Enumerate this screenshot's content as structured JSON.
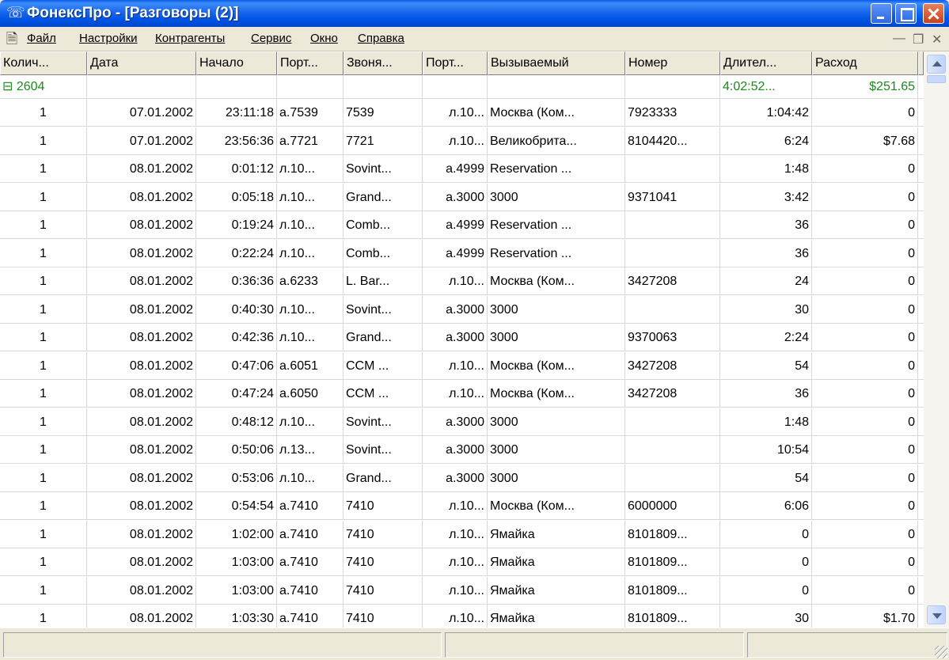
{
  "window": {
    "title": "ФонексПро - [Разговоры (2)]",
    "icon": "phone-icon"
  },
  "menu": {
    "items": [
      "Файл",
      "Настройки",
      "Контрагенты",
      "Сервис",
      "Окно",
      "Справка"
    ]
  },
  "columns": [
    "Колич...",
    "Дата",
    "Начало",
    "Порт...",
    "Звоня...",
    "Порт...",
    "Вызываемый",
    "Номер",
    "Длител...",
    "Расход"
  ],
  "group": {
    "count": "2604",
    "duration": "4:02:52...",
    "cost": "$251.65"
  },
  "rows": [
    [
      "1",
      "07.01.2002",
      "23:11:18",
      "а.7539",
      "7539",
      "л.10...",
      "Москва (Ком...",
      "7923333",
      "1:04:42",
      "0"
    ],
    [
      "1",
      "07.01.2002",
      "23:56:36",
      "а.7721",
      "7721",
      "л.10...",
      "Великобрита...",
      "8104420...",
      "6:24",
      "$7.68"
    ],
    [
      "1",
      "08.01.2002",
      "0:01:12",
      "л.10...",
      "Sovint...",
      "а.4999",
      "Reservation ...",
      "",
      "1:48",
      "0"
    ],
    [
      "1",
      "08.01.2002",
      "0:05:18",
      "л.10...",
      "Grand...",
      "а.3000",
      "3000",
      "9371041",
      "3:42",
      "0"
    ],
    [
      "1",
      "08.01.2002",
      "0:19:24",
      "л.10...",
      "Comb...",
      "а.4999",
      "Reservation ...",
      "",
      "36",
      "0"
    ],
    [
      "1",
      "08.01.2002",
      "0:22:24",
      "л.10...",
      "Comb...",
      "а.4999",
      "Reservation ...",
      "",
      "36",
      "0"
    ],
    [
      "1",
      "08.01.2002",
      "0:36:36",
      "а.6233",
      "L. Bar...",
      "л.10...",
      "Москва (Ком...",
      "3427208",
      "24",
      "0"
    ],
    [
      "1",
      "08.01.2002",
      "0:40:30",
      "л.10...",
      "Sovint...",
      "а.3000",
      "3000",
      "",
      "30",
      "0"
    ],
    [
      "1",
      "08.01.2002",
      "0:42:36",
      "л.10...",
      "Grand...",
      "а.3000",
      "3000",
      "9370063",
      "2:24",
      "0"
    ],
    [
      "1",
      "08.01.2002",
      "0:47:06",
      "а.6051",
      "CCM ...",
      "л.10...",
      "Москва (Ком...",
      "3427208",
      "54",
      "0"
    ],
    [
      "1",
      "08.01.2002",
      "0:47:24",
      "а.6050",
      "CCM ...",
      "л.10...",
      "Москва (Ком...",
      "3427208",
      "36",
      "0"
    ],
    [
      "1",
      "08.01.2002",
      "0:48:12",
      "л.10...",
      "Sovint...",
      "а.3000",
      "3000",
      "",
      "1:48",
      "0"
    ],
    [
      "1",
      "08.01.2002",
      "0:50:06",
      "л.13...",
      "Sovint...",
      "а.3000",
      "3000",
      "",
      "10:54",
      "0"
    ],
    [
      "1",
      "08.01.2002",
      "0:53:06",
      "л.10...",
      "Grand...",
      "а.3000",
      "3000",
      "",
      "54",
      "0"
    ],
    [
      "1",
      "08.01.2002",
      "0:54:54",
      "а.7410",
      "7410",
      "л.10...",
      "Москва (Ком...",
      "6000000",
      "6:06",
      "0"
    ],
    [
      "1",
      "08.01.2002",
      "1:02:00",
      "а.7410",
      "7410",
      "л.10...",
      "Ямайка",
      "8101809...",
      "0",
      "0"
    ],
    [
      "1",
      "08.01.2002",
      "1:03:00",
      "а.7410",
      "7410",
      "л.10...",
      "Ямайка",
      "8101809...",
      "0",
      "0"
    ],
    [
      "1",
      "08.01.2002",
      "1:03:00",
      "а.7410",
      "7410",
      "л.10...",
      "Ямайка",
      "8101809...",
      "0",
      "0"
    ],
    [
      "1",
      "08.01.2002",
      "1:03:30",
      "а.7410",
      "7410",
      "л.10...",
      "Ямайка",
      "8101809...",
      "30",
      "$1.70"
    ]
  ],
  "colors": {
    "titlebar": "#0055e5",
    "group_text": "#1a8a1a"
  }
}
